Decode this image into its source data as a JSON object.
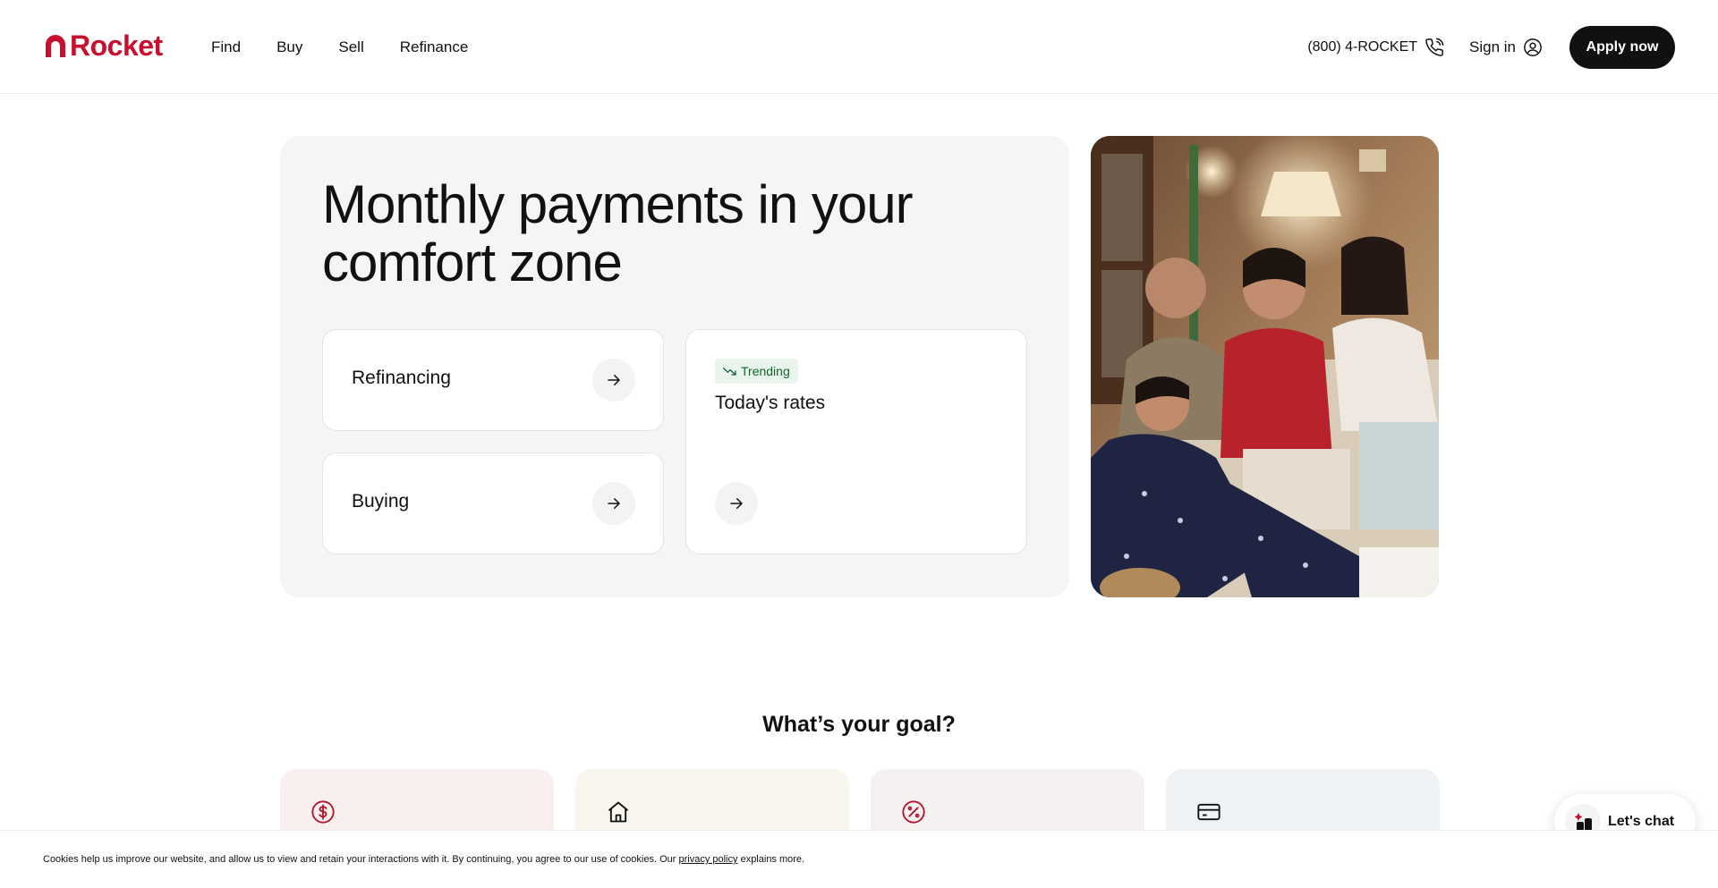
{
  "header": {
    "logo_text": "Rocket",
    "nav": [
      "Find",
      "Buy",
      "Sell",
      "Refinance"
    ],
    "phone": "(800) 4-ROCKET",
    "sign_in": "Sign in",
    "apply": "Apply now"
  },
  "hero": {
    "title": "Monthly payments in your comfort zone",
    "cards": {
      "refinancing": "Refinancing",
      "buying": "Buying",
      "rates_badge": "Trending",
      "rates_label": "Today's rates"
    }
  },
  "goals": {
    "title": "What’s your goal?",
    "cards": [
      {
        "icon": "dollar-circle-icon",
        "bg": "#f9efee"
      },
      {
        "icon": "house-icon",
        "bg": "#f8f6ec"
      },
      {
        "icon": "percent-badge-icon",
        "bg": "#f6f1f1"
      },
      {
        "icon": "credit-card-icon",
        "bg": "#eff2f5"
      }
    ]
  },
  "chat": {
    "label": "Let's chat"
  },
  "cookie": {
    "text_before": "Cookies help us improve our website, and allow us to view and retain your interactions with it. By continuing, you agree to our use of cookies. Our ",
    "link": "privacy policy",
    "text_after": " explains more."
  },
  "colors": {
    "brand": "#c8102e",
    "dark": "#111111",
    "trend_green": "#15622f"
  }
}
